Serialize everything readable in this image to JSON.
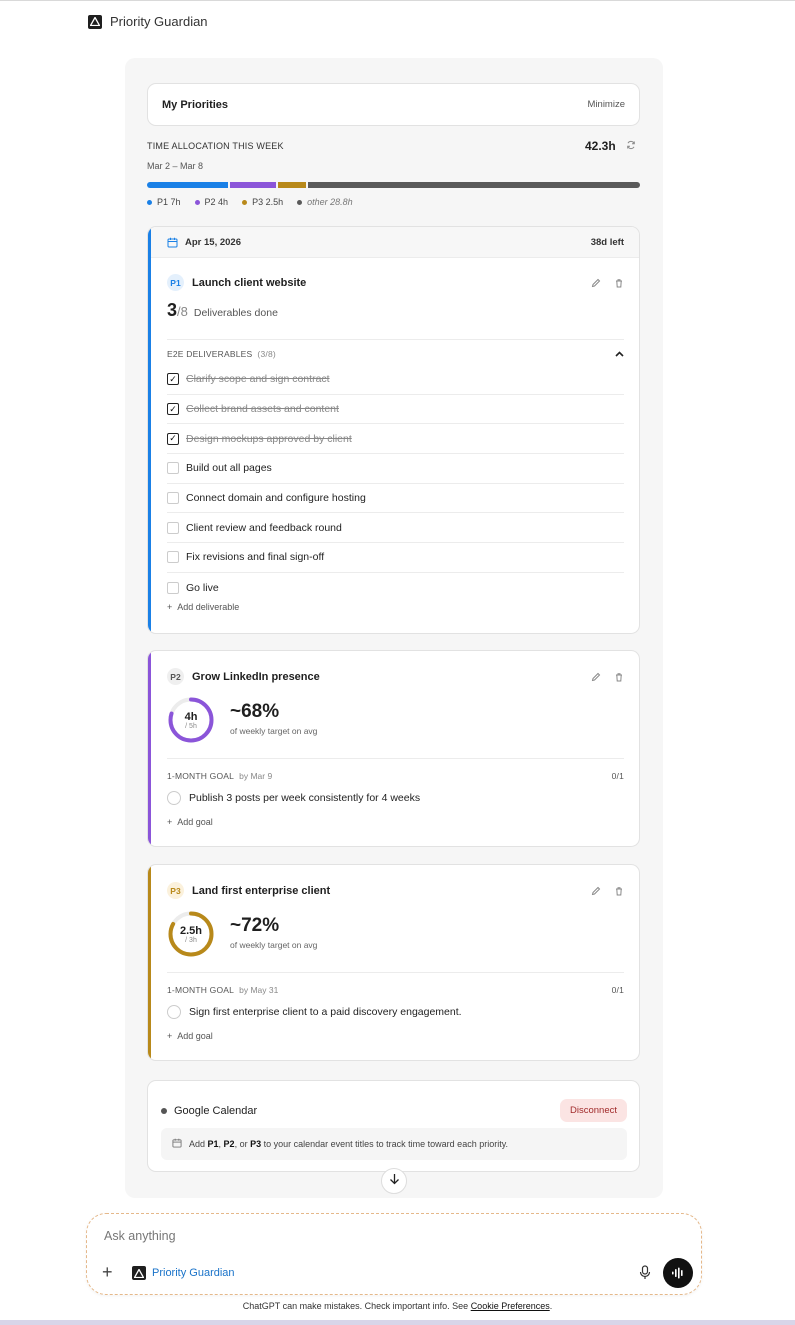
{
  "app": {
    "name": "Priority Guardian"
  },
  "widget": {
    "title": "My Priorities",
    "minimize_label": "Minimize"
  },
  "time_allocation": {
    "label": "TIME ALLOCATION THIS WEEK",
    "range": "Mar 2 – Mar 8",
    "total": "42.3h",
    "segments": [
      {
        "name": "P1",
        "hours": 7,
        "color": "#1a80e6"
      },
      {
        "name": "P2",
        "hours": 4,
        "color": "#8b55d9"
      },
      {
        "name": "P3",
        "hours": 2.5,
        "color": "#b8891a"
      },
      {
        "name": "other",
        "hours": 28.8,
        "color": "#5a5a5a"
      }
    ],
    "legend": [
      "P1 7h",
      "P2 4h",
      "P3 2.5h",
      "other 28.8h"
    ]
  },
  "p1": {
    "badge": "P1",
    "color": "#1a80e6",
    "date": "Apr 15, 2026",
    "days_left": "38d left",
    "title": "Launch client website",
    "done_count": "3",
    "total_count": "/8",
    "done_label": "Deliverables done",
    "section_label": "E2E DELIVERABLES",
    "section_count": "(3/8)",
    "deliverables": [
      {
        "text": "Clarify scope and sign contract",
        "done": true
      },
      {
        "text": "Collect brand assets and content",
        "done": true
      },
      {
        "text": "Design mockups approved by client",
        "done": true
      },
      {
        "text": "Build out all pages",
        "done": false
      },
      {
        "text": "Connect domain and configure hosting",
        "done": false
      },
      {
        "text": "Client review and feedback round",
        "done": false
      },
      {
        "text": "Fix revisions and final sign-off",
        "done": false
      },
      {
        "text": "Go live",
        "done": false
      }
    ],
    "add_label": "Add deliverable"
  },
  "p2": {
    "badge": "P2",
    "color": "#8b55d9",
    "title": "Grow LinkedIn presence",
    "hours": "4h",
    "target": "/ 5h",
    "progress": 0.8,
    "percent": "~68%",
    "percent_label": "of weekly target on avg",
    "goal_label": "1-MONTH GOAL",
    "goal_by": "by Mar 9",
    "goal_count": "0/1",
    "goal_text": "Publish 3 posts per week consistently for 4 weeks",
    "add_label": "Add goal"
  },
  "p3": {
    "badge": "P3",
    "color": "#b8891a",
    "title": "Land first enterprise client",
    "hours": "2.5h",
    "target": "/ 3h",
    "progress": 0.83,
    "percent": "~72%",
    "percent_label": "of weekly target on avg",
    "goal_label": "1-MONTH GOAL",
    "goal_by": "by May 31",
    "goal_count": "0/1",
    "goal_text": "Sign first enterprise client to a paid discovery engagement.",
    "add_label": "Add goal"
  },
  "gcal": {
    "name": "Google Calendar",
    "disconnect_label": "Disconnect",
    "hint_pre": "Add ",
    "hint_p1": "P1",
    "hint_sep1": ", ",
    "hint_p2": "P2",
    "hint_sep2": ", or ",
    "hint_p3": "P3",
    "hint_post": " to your calendar event titles to track time toward each priority."
  },
  "composer": {
    "placeholder": "Ask anything",
    "app_chip": "Priority Guardian"
  },
  "footer": {
    "text": "ChatGPT can make mistakes. Check important info. See ",
    "link": "Cookie Preferences",
    "end": "."
  }
}
